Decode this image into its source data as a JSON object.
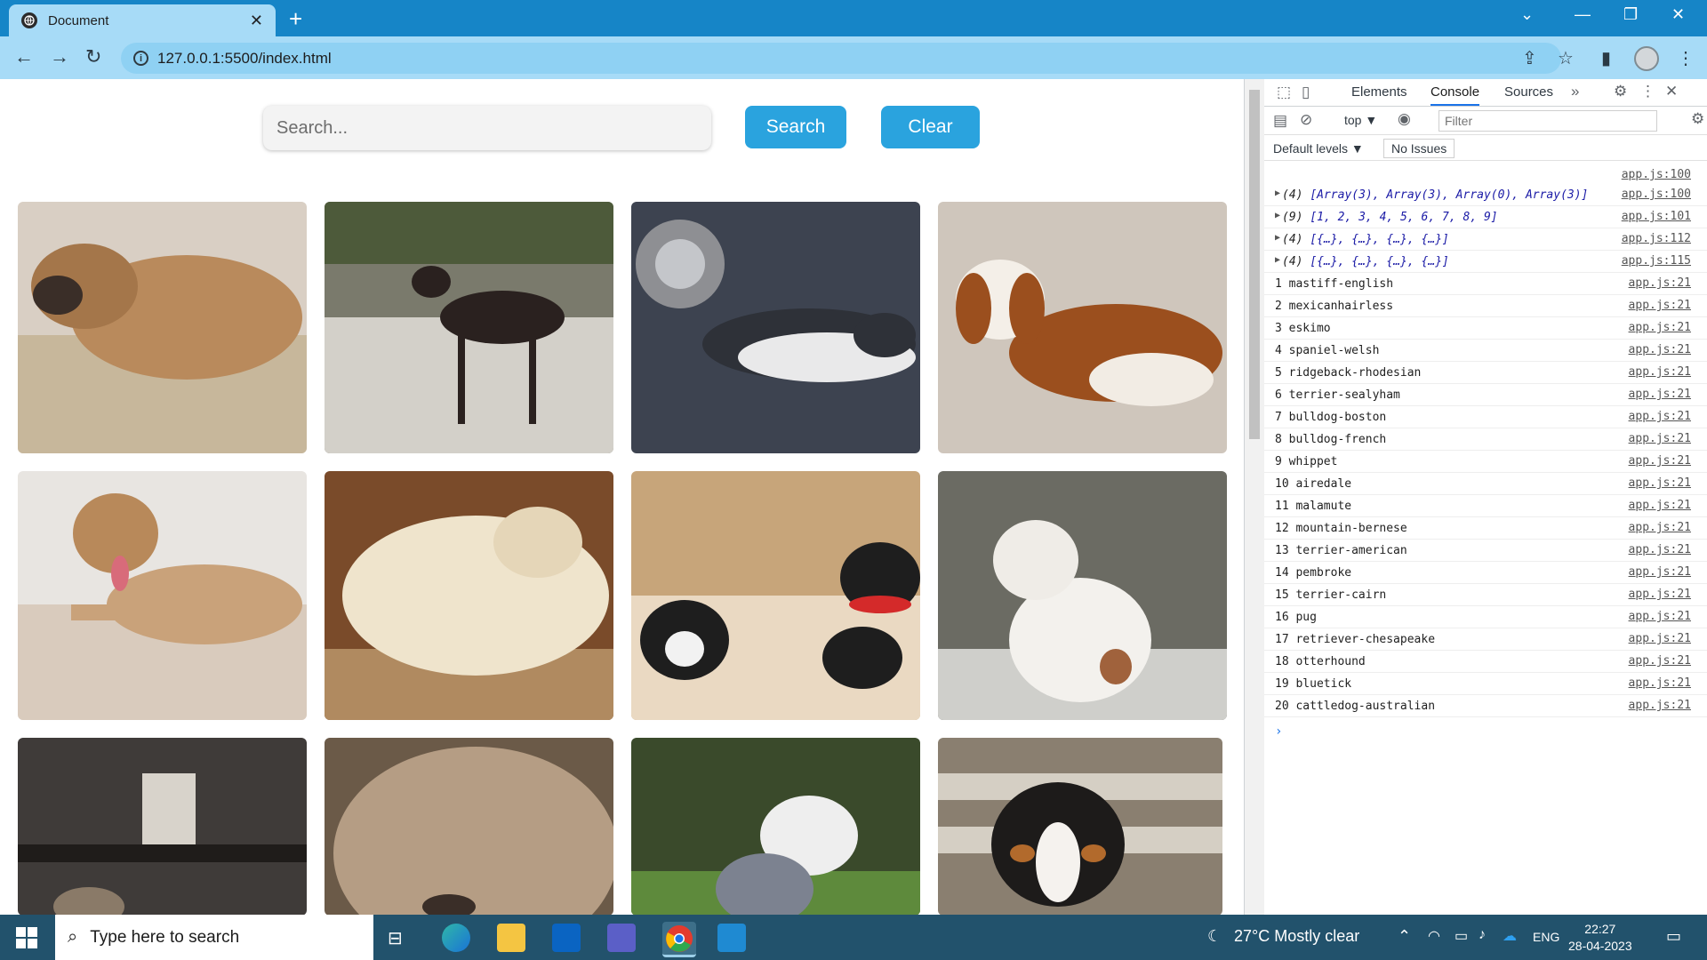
{
  "browser": {
    "tab_title": "Document",
    "new_tab_symbol": "+",
    "url": "127.0.0.1:5500/index.html"
  },
  "page": {
    "search_placeholder": "Search...",
    "search_button": "Search",
    "clear_button": "Clear",
    "images": [
      {
        "alt": "mastiff-english",
        "color": "#b98a5c"
      },
      {
        "alt": "mexicanhairless",
        "color": "#6e6d6a"
      },
      {
        "alt": "eskimo",
        "color": "#4b5058"
      },
      {
        "alt": "spaniel-welsh",
        "color": "#cfc6bc"
      },
      {
        "alt": "ridgeback-rhodesian",
        "color": "#c9a27a"
      },
      {
        "alt": "terrier-sealyham",
        "color": "#d8c7a6"
      },
      {
        "alt": "bulldog-boston",
        "color": "#c7a57a"
      },
      {
        "alt": "bulldog-french",
        "color": "#9a968c"
      },
      {
        "alt": "whippet",
        "color": "#4a4a4a"
      },
      {
        "alt": "airedale",
        "color": "#b59d84"
      },
      {
        "alt": "malamute",
        "color": "#4f6a3a"
      },
      {
        "alt": "mountain-bernese",
        "color": "#8a7f70"
      }
    ]
  },
  "devtools": {
    "tabs": [
      "Elements",
      "Console",
      "Sources"
    ],
    "active_tab": "Console",
    "context": "top",
    "filter_placeholder": "Filter",
    "levels": "Default levels",
    "issues": "No Issues",
    "first_source": "app.js:100",
    "objects": [
      {
        "count": "(4)",
        "text": "[Array(3), Array(3), Array(0), Array(3)]",
        "src": "app.js:100"
      },
      {
        "count": "(9)",
        "text": "[1, 2, 3, 4, 5, 6, 7, 8, 9]",
        "src": "app.js:101"
      },
      {
        "count": "(4)",
        "text": "[{…}, {…}, {…}, {…}]",
        "src": "app.js:112"
      },
      {
        "count": "(4)",
        "text": "[{…}, {…}, {…}, {…}]",
        "src": "app.js:115"
      }
    ],
    "logs": [
      {
        "n": "1",
        "name": "mastiff-english",
        "src": "app.js:21"
      },
      {
        "n": "2",
        "name": "mexicanhairless",
        "src": "app.js:21"
      },
      {
        "n": "3",
        "name": "eskimo",
        "src": "app.js:21"
      },
      {
        "n": "4",
        "name": "spaniel-welsh",
        "src": "app.js:21"
      },
      {
        "n": "5",
        "name": "ridgeback-rhodesian",
        "src": "app.js:21"
      },
      {
        "n": "6",
        "name": "terrier-sealyham",
        "src": "app.js:21"
      },
      {
        "n": "7",
        "name": "bulldog-boston",
        "src": "app.js:21"
      },
      {
        "n": "8",
        "name": "bulldog-french",
        "src": "app.js:21"
      },
      {
        "n": "9",
        "name": "whippet",
        "src": "app.js:21"
      },
      {
        "n": "10",
        "name": "airedale",
        "src": "app.js:21"
      },
      {
        "n": "11",
        "name": "malamute",
        "src": "app.js:21"
      },
      {
        "n": "12",
        "name": "mountain-bernese",
        "src": "app.js:21"
      },
      {
        "n": "13",
        "name": "terrier-american",
        "src": "app.js:21"
      },
      {
        "n": "14",
        "name": "pembroke",
        "src": "app.js:21"
      },
      {
        "n": "15",
        "name": "terrier-cairn",
        "src": "app.js:21"
      },
      {
        "n": "16",
        "name": "pug",
        "src": "app.js:21"
      },
      {
        "n": "17",
        "name": "retriever-chesapeake",
        "src": "app.js:21"
      },
      {
        "n": "18",
        "name": "otterhound",
        "src": "app.js:21"
      },
      {
        "n": "19",
        "name": "bluetick",
        "src": "app.js:21"
      },
      {
        "n": "20",
        "name": "cattledog-australian",
        "src": "app.js:21"
      }
    ]
  },
  "taskbar": {
    "search_placeholder": "Type here to search",
    "weather": "27°C  Mostly clear",
    "lang": "ENG",
    "time": "22:27",
    "date": "28-04-2023"
  },
  "colors": {
    "chrome_titlebar": "#1685c7",
    "chrome_toolbar": "#a7dbf7",
    "button_accent": "#2aa3de",
    "taskbar": "#22526c"
  }
}
